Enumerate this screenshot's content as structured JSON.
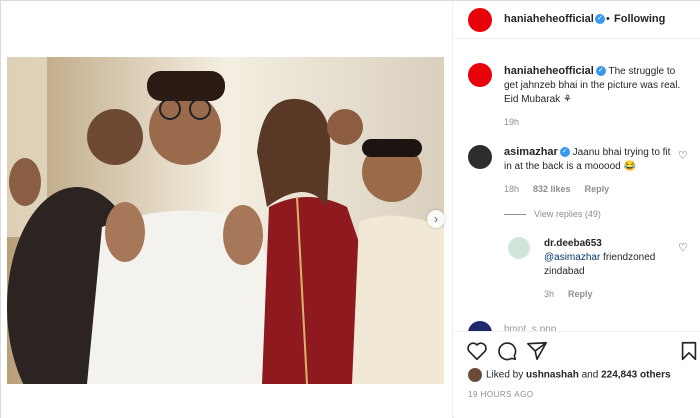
{
  "header": {
    "username": "haniaheheofficial",
    "dot": "•",
    "follow_label": "Following",
    "more": "•••"
  },
  "caption": {
    "username": "haniaheheofficial",
    "text": "The struggle to get jahnzeb bhai in the picture was real. Eid Mubarak ⚘",
    "time": "19h"
  },
  "comment": {
    "username": "asimazhar",
    "text": "Jaanu bhai trying to fit in at the back is a mooood 😂",
    "time": "18h",
    "likes": "832 likes",
    "reply_label": "Reply",
    "view_replies": "View replies (49)"
  },
  "reply": {
    "username": "dr.deeba653",
    "mention": "@asimazhar",
    "text": " friendzoned zindabad",
    "time": "3h",
    "reply_label": "Reply"
  },
  "partial_comment": {
    "username": "bmnt_s ppp"
  },
  "likes": {
    "prefix": "Liked by ",
    "user": "ushnashah",
    "middle": " and ",
    "others": "224,843 others"
  },
  "timestamp": "19 HOURS AGO",
  "icons": {
    "like": "heart-icon",
    "comment": "comment-icon",
    "share": "share-icon",
    "save": "bookmark-icon",
    "next": "chevron-right-icon"
  },
  "colors": {
    "avatar_red": "#e8000b",
    "verified_blue": "#3897f0",
    "text": "#262626",
    "muted": "#8e8e8e"
  }
}
